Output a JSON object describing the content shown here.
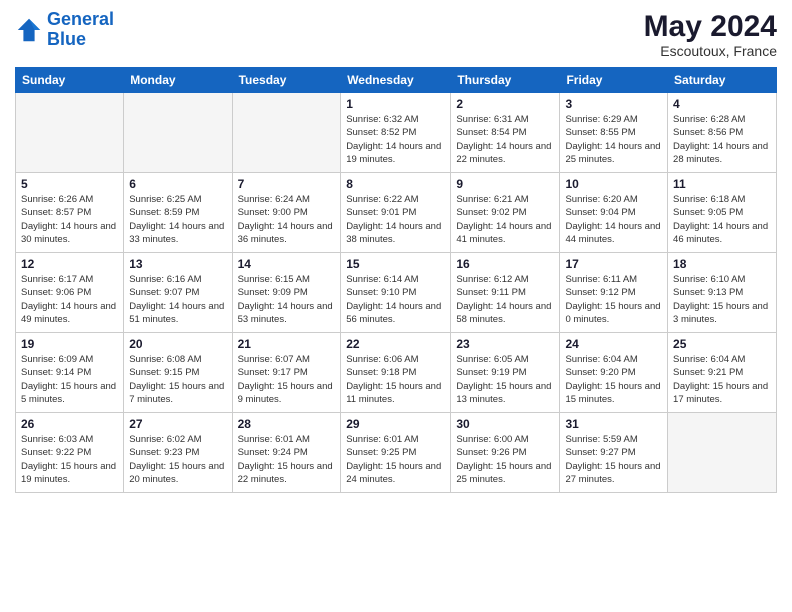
{
  "header": {
    "logo_line1": "General",
    "logo_line2": "Blue",
    "main_title": "May 2024",
    "subtitle": "Escoutoux, France"
  },
  "weekdays": [
    "Sunday",
    "Monday",
    "Tuesday",
    "Wednesday",
    "Thursday",
    "Friday",
    "Saturday"
  ],
  "weeks": [
    [
      {
        "num": "",
        "info": ""
      },
      {
        "num": "",
        "info": ""
      },
      {
        "num": "",
        "info": ""
      },
      {
        "num": "1",
        "info": "Sunrise: 6:32 AM\nSunset: 8:52 PM\nDaylight: 14 hours\nand 19 minutes."
      },
      {
        "num": "2",
        "info": "Sunrise: 6:31 AM\nSunset: 8:54 PM\nDaylight: 14 hours\nand 22 minutes."
      },
      {
        "num": "3",
        "info": "Sunrise: 6:29 AM\nSunset: 8:55 PM\nDaylight: 14 hours\nand 25 minutes."
      },
      {
        "num": "4",
        "info": "Sunrise: 6:28 AM\nSunset: 8:56 PM\nDaylight: 14 hours\nand 28 minutes."
      }
    ],
    [
      {
        "num": "5",
        "info": "Sunrise: 6:26 AM\nSunset: 8:57 PM\nDaylight: 14 hours\nand 30 minutes."
      },
      {
        "num": "6",
        "info": "Sunrise: 6:25 AM\nSunset: 8:59 PM\nDaylight: 14 hours\nand 33 minutes."
      },
      {
        "num": "7",
        "info": "Sunrise: 6:24 AM\nSunset: 9:00 PM\nDaylight: 14 hours\nand 36 minutes."
      },
      {
        "num": "8",
        "info": "Sunrise: 6:22 AM\nSunset: 9:01 PM\nDaylight: 14 hours\nand 38 minutes."
      },
      {
        "num": "9",
        "info": "Sunrise: 6:21 AM\nSunset: 9:02 PM\nDaylight: 14 hours\nand 41 minutes."
      },
      {
        "num": "10",
        "info": "Sunrise: 6:20 AM\nSunset: 9:04 PM\nDaylight: 14 hours\nand 44 minutes."
      },
      {
        "num": "11",
        "info": "Sunrise: 6:18 AM\nSunset: 9:05 PM\nDaylight: 14 hours\nand 46 minutes."
      }
    ],
    [
      {
        "num": "12",
        "info": "Sunrise: 6:17 AM\nSunset: 9:06 PM\nDaylight: 14 hours\nand 49 minutes."
      },
      {
        "num": "13",
        "info": "Sunrise: 6:16 AM\nSunset: 9:07 PM\nDaylight: 14 hours\nand 51 minutes."
      },
      {
        "num": "14",
        "info": "Sunrise: 6:15 AM\nSunset: 9:09 PM\nDaylight: 14 hours\nand 53 minutes."
      },
      {
        "num": "15",
        "info": "Sunrise: 6:14 AM\nSunset: 9:10 PM\nDaylight: 14 hours\nand 56 minutes."
      },
      {
        "num": "16",
        "info": "Sunrise: 6:12 AM\nSunset: 9:11 PM\nDaylight: 14 hours\nand 58 minutes."
      },
      {
        "num": "17",
        "info": "Sunrise: 6:11 AM\nSunset: 9:12 PM\nDaylight: 15 hours\nand 0 minutes."
      },
      {
        "num": "18",
        "info": "Sunrise: 6:10 AM\nSunset: 9:13 PM\nDaylight: 15 hours\nand 3 minutes."
      }
    ],
    [
      {
        "num": "19",
        "info": "Sunrise: 6:09 AM\nSunset: 9:14 PM\nDaylight: 15 hours\nand 5 minutes."
      },
      {
        "num": "20",
        "info": "Sunrise: 6:08 AM\nSunset: 9:15 PM\nDaylight: 15 hours\nand 7 minutes."
      },
      {
        "num": "21",
        "info": "Sunrise: 6:07 AM\nSunset: 9:17 PM\nDaylight: 15 hours\nand 9 minutes."
      },
      {
        "num": "22",
        "info": "Sunrise: 6:06 AM\nSunset: 9:18 PM\nDaylight: 15 hours\nand 11 minutes."
      },
      {
        "num": "23",
        "info": "Sunrise: 6:05 AM\nSunset: 9:19 PM\nDaylight: 15 hours\nand 13 minutes."
      },
      {
        "num": "24",
        "info": "Sunrise: 6:04 AM\nSunset: 9:20 PM\nDaylight: 15 hours\nand 15 minutes."
      },
      {
        "num": "25",
        "info": "Sunrise: 6:04 AM\nSunset: 9:21 PM\nDaylight: 15 hours\nand 17 minutes."
      }
    ],
    [
      {
        "num": "26",
        "info": "Sunrise: 6:03 AM\nSunset: 9:22 PM\nDaylight: 15 hours\nand 19 minutes."
      },
      {
        "num": "27",
        "info": "Sunrise: 6:02 AM\nSunset: 9:23 PM\nDaylight: 15 hours\nand 20 minutes."
      },
      {
        "num": "28",
        "info": "Sunrise: 6:01 AM\nSunset: 9:24 PM\nDaylight: 15 hours\nand 22 minutes."
      },
      {
        "num": "29",
        "info": "Sunrise: 6:01 AM\nSunset: 9:25 PM\nDaylight: 15 hours\nand 24 minutes."
      },
      {
        "num": "30",
        "info": "Sunrise: 6:00 AM\nSunset: 9:26 PM\nDaylight: 15 hours\nand 25 minutes."
      },
      {
        "num": "31",
        "info": "Sunrise: 5:59 AM\nSunset: 9:27 PM\nDaylight: 15 hours\nand 27 minutes."
      },
      {
        "num": "",
        "info": ""
      }
    ]
  ]
}
